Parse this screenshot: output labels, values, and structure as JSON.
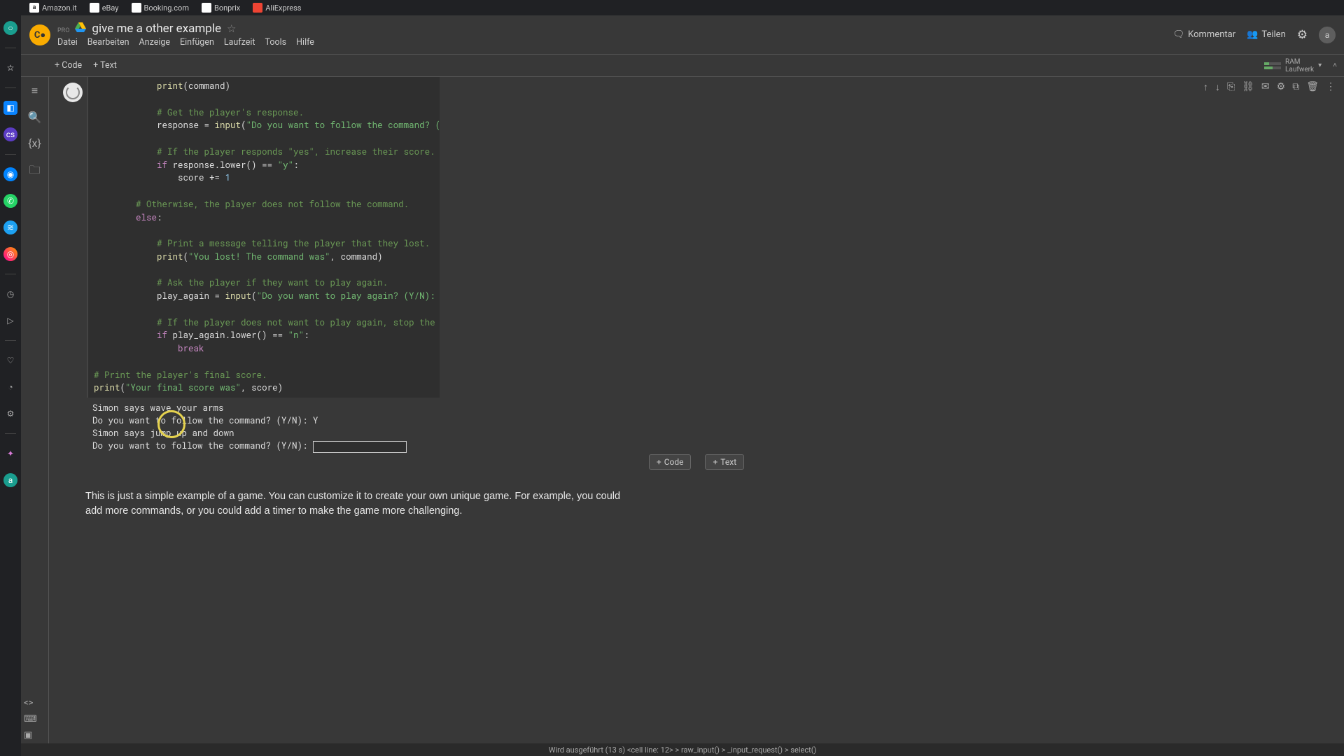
{
  "browser_tabs": [
    {
      "label": "Amazon.it",
      "fav_bg": "#fff",
      "fav_txt": "a",
      "fav_color": "#333"
    },
    {
      "label": "eBay",
      "fav_bg": "#fff",
      "fav_txt": "",
      "fav_color": "#333"
    },
    {
      "label": "Booking.com",
      "fav_bg": "#fff",
      "fav_txt": "",
      "fav_color": "#333"
    },
    {
      "label": "Bonprix",
      "fav_bg": "#fff",
      "fav_txt": "",
      "fav_color": "#333"
    },
    {
      "label": "AliExpress",
      "fav_bg": "#e43",
      "fav_txt": "",
      "fav_color": "#fff"
    }
  ],
  "doc_title": "give me a other example",
  "pro_label": "PRO",
  "menu": [
    "Datei",
    "Bearbeiten",
    "Anzeige",
    "Einfügen",
    "Laufzeit",
    "Tools",
    "Hilfe"
  ],
  "right": {
    "comment": "Kommentar",
    "share": "Teilen",
    "avatar": "a"
  },
  "toolbar": {
    "code": "+ Code",
    "text": "+ Text",
    "ram": "RAM",
    "disk": "Laufwerk"
  },
  "code_lines": [
    {
      "i": "            ",
      "t": [
        {
          "c": "fn",
          "v": "print"
        },
        {
          "c": "op",
          "v": "(command)"
        }
      ]
    },
    {
      "i": "",
      "t": []
    },
    {
      "i": "            ",
      "t": [
        {
          "c": "cmt",
          "v": "# Get the player's response."
        }
      ]
    },
    {
      "i": "            ",
      "t": [
        {
          "c": "op",
          "v": "response "
        },
        {
          "c": "op",
          "v": "= "
        },
        {
          "c": "fn",
          "v": "input"
        },
        {
          "c": "op",
          "v": "("
        },
        {
          "c": "str",
          "v": "\"Do you want to follow the command? (Y/N): \""
        },
        {
          "c": "op",
          "v": ")"
        }
      ]
    },
    {
      "i": "",
      "t": []
    },
    {
      "i": "            ",
      "t": [
        {
          "c": "cmt",
          "v": "# If the player responds \"yes\", increase their score."
        }
      ]
    },
    {
      "i": "            ",
      "t": [
        {
          "c": "kw",
          "v": "if"
        },
        {
          "c": "op",
          "v": " response.lower() "
        },
        {
          "c": "op",
          "v": "== "
        },
        {
          "c": "str",
          "v": "\"y\""
        },
        {
          "c": "op",
          "v": ":"
        }
      ]
    },
    {
      "i": "                ",
      "t": [
        {
          "c": "op",
          "v": "score "
        },
        {
          "c": "op",
          "v": "+= "
        },
        {
          "c": "num",
          "v": "1"
        }
      ]
    },
    {
      "i": "",
      "t": []
    },
    {
      "i": "        ",
      "t": [
        {
          "c": "cmt",
          "v": "# Otherwise, the player does not follow the command."
        }
      ]
    },
    {
      "i": "        ",
      "t": [
        {
          "c": "kw",
          "v": "else"
        },
        {
          "c": "op",
          "v": ":"
        }
      ]
    },
    {
      "i": "",
      "t": []
    },
    {
      "i": "            ",
      "t": [
        {
          "c": "cmt",
          "v": "# Print a message telling the player that they lost."
        }
      ]
    },
    {
      "i": "            ",
      "t": [
        {
          "c": "fn",
          "v": "print"
        },
        {
          "c": "op",
          "v": "("
        },
        {
          "c": "str",
          "v": "\"You lost! The command was\""
        },
        {
          "c": "op",
          "v": ", command)"
        }
      ]
    },
    {
      "i": "",
      "t": []
    },
    {
      "i": "            ",
      "t": [
        {
          "c": "cmt",
          "v": "# Ask the player if they want to play again."
        }
      ]
    },
    {
      "i": "            ",
      "t": [
        {
          "c": "op",
          "v": "play_again "
        },
        {
          "c": "op",
          "v": "= "
        },
        {
          "c": "fn",
          "v": "input"
        },
        {
          "c": "op",
          "v": "("
        },
        {
          "c": "str",
          "v": "\"Do you want to play again? (Y/N): \""
        },
        {
          "c": "op",
          "v": ")"
        }
      ]
    },
    {
      "i": "",
      "t": []
    },
    {
      "i": "            ",
      "t": [
        {
          "c": "cmt",
          "v": "# If the player does not want to play again, stop the game."
        }
      ]
    },
    {
      "i": "            ",
      "t": [
        {
          "c": "kw",
          "v": "if"
        },
        {
          "c": "op",
          "v": " play_again.lower() "
        },
        {
          "c": "op",
          "v": "== "
        },
        {
          "c": "str",
          "v": "\"n\""
        },
        {
          "c": "op",
          "v": ":"
        }
      ]
    },
    {
      "i": "                ",
      "t": [
        {
          "c": "kw",
          "v": "break"
        }
      ]
    },
    {
      "i": "",
      "t": []
    },
    {
      "i": "",
      "t": [
        {
          "c": "cmt",
          "v": "# Print the player's final score."
        }
      ]
    },
    {
      "i": "",
      "t": [
        {
          "c": "fn",
          "v": "print"
        },
        {
          "c": "op",
          "v": "("
        },
        {
          "c": "str",
          "v": "\"Your final score was\""
        },
        {
          "c": "op",
          "v": ", score)"
        }
      ]
    }
  ],
  "output": {
    "l1": "Simon says wave your arms",
    "l2": "Do you want to follow the command? (Y/N): Y",
    "l3": "Simon says jump up and down",
    "l4": "Do you want to follow the command? (Y/N): "
  },
  "insert": {
    "code": "Code",
    "text": "Text"
  },
  "text_cell": "This is just a simple example of a game. You can customize it to create your own unique game. For example, you could add more commands, or you could add a timer to make the game more challenging.",
  "status": "Wird ausgeführt (13 s)  <cell line: 12>  >  raw_input()  >  _input_request()  >  select()",
  "cell_actions": [
    "↑",
    "↓",
    "⎘",
    "⛓",
    "✉",
    "⚙",
    "⧉",
    "🗑",
    "⋮"
  ]
}
